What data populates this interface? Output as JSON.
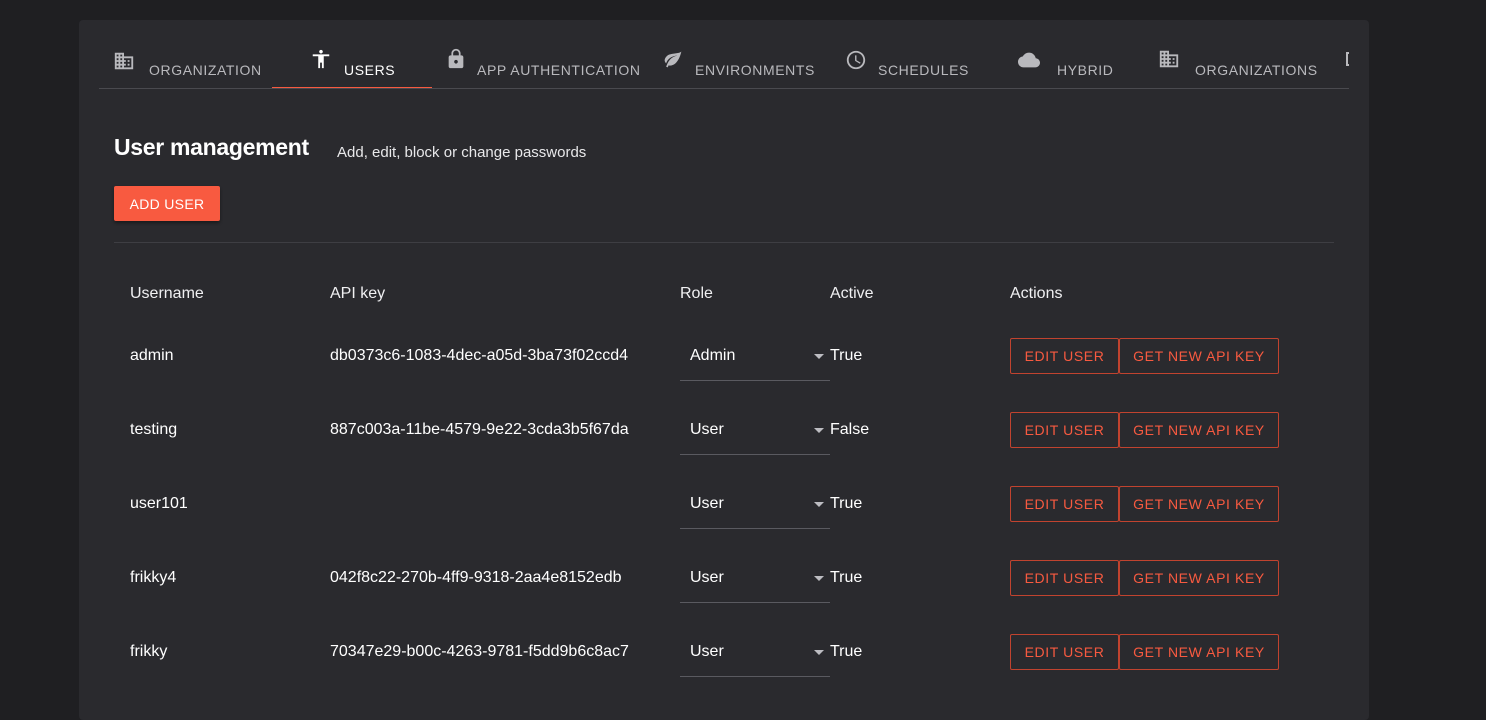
{
  "tabs": [
    {
      "label": "Organization",
      "icon": "building-icon"
    },
    {
      "label": "Users",
      "icon": "accessibility-icon",
      "active": true
    },
    {
      "label": "App Authentication",
      "icon": "lock-icon"
    },
    {
      "label": "Environments",
      "icon": "leaf-icon"
    },
    {
      "label": "Schedules",
      "icon": "clock-icon"
    },
    {
      "label": "Hybrid",
      "icon": "cloud-icon"
    },
    {
      "label": "Organizations",
      "icon": "building-icon"
    }
  ],
  "header": {
    "title": "User management",
    "subtitle": "Add, edit, block or change passwords",
    "add_user_label": "ADD USER"
  },
  "table": {
    "columns": [
      "Username",
      "API key",
      "Role",
      "Active",
      "Actions"
    ],
    "rows": [
      {
        "username": "admin",
        "api_key": "db0373c6-1083-4dec-a05d-3ba73f02ccd4",
        "role": "Admin",
        "active": "True"
      },
      {
        "username": "testing",
        "api_key": "887c003a-11be-4579-9e22-3cda3b5f67da",
        "role": "User",
        "active": "False"
      },
      {
        "username": "user101",
        "api_key": "",
        "role": "User",
        "active": "True"
      },
      {
        "username": "frikky4",
        "api_key": "042f8c22-270b-4ff9-9318-2aa4e8152edb",
        "role": "User",
        "active": "True"
      },
      {
        "username": "frikky",
        "api_key": "70347e29-b00c-4263-9781-f5dd9b6c8ac7",
        "role": "User",
        "active": "True"
      }
    ],
    "edit_user_label": "EDIT USER",
    "new_api_key_label": "GET NEW API KEY"
  },
  "colors": {
    "accent": "#f85a40",
    "background": "#1f1f22",
    "panel": "#2a2a2e"
  }
}
